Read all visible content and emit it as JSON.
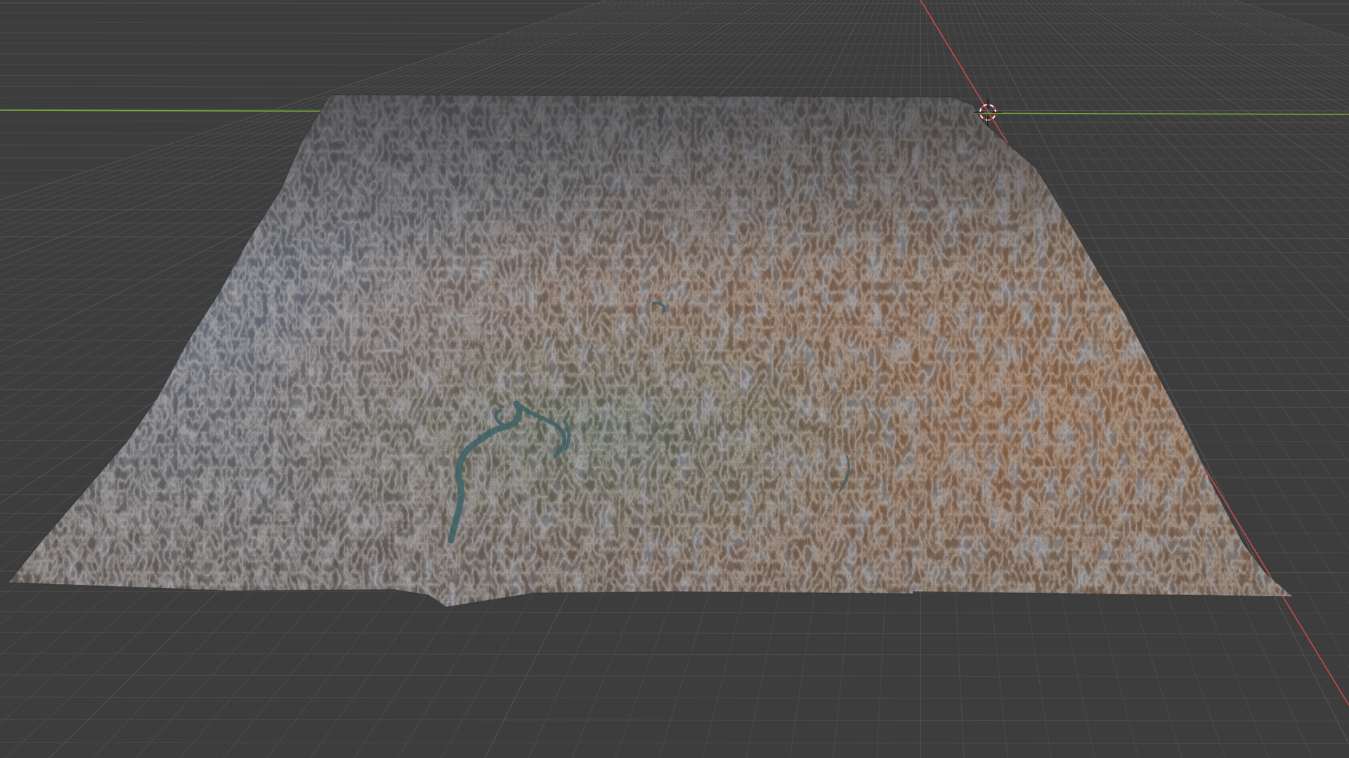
{
  "viewport": {
    "background_color": "#3d3d3d",
    "grid_color": "#4b4b4b",
    "grid_major_color": "#555555",
    "x_axis_color": "#c84a4a",
    "y_axis_color": "#7aa63a"
  },
  "terrain": {
    "colors": {
      "rock_blue": "#5a6270",
      "rock_dark": "#3f444d",
      "earth_brown": "#7a5a44",
      "earth_rust": "#8a5f40",
      "valley_green": "#4f6257",
      "water": "#3f6266"
    }
  },
  "cursor_3d": {
    "icon": "3d-cursor-icon",
    "ring_color_a": "#d23a3a",
    "ring_color_b": "#f2f2f2"
  }
}
